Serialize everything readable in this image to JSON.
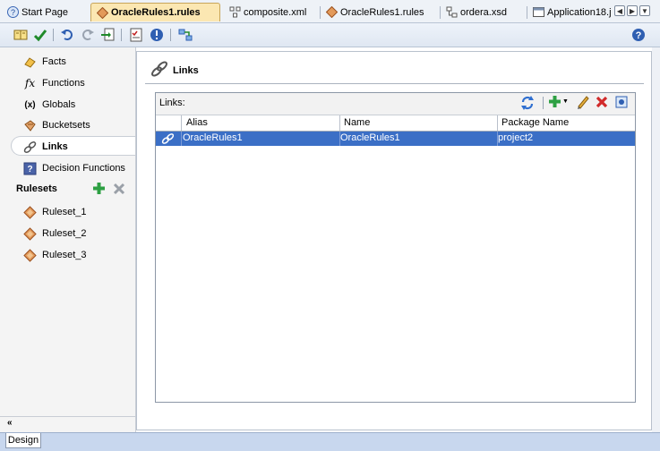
{
  "tabs": [
    {
      "label": "Start Page",
      "icon": "help-icon",
      "active": false
    },
    {
      "label": "OracleRules1.rules",
      "icon": "rules-diamond-icon",
      "active": true
    },
    {
      "label": "composite.xml",
      "icon": "composite-icon",
      "active": false
    },
    {
      "label": "OracleRules1.rules",
      "icon": "rules-diamond-icon",
      "active": false
    },
    {
      "label": "ordera.xsd",
      "icon": "xsd-icon",
      "active": false
    },
    {
      "label": "Application18.j",
      "icon": "application-icon",
      "active": false
    }
  ],
  "toolbar": {
    "items": [
      "dictionary-icon",
      "validate-check-icon",
      "undo-icon",
      "redo-icon",
      "import-icon",
      "checklist-icon",
      "info-icon",
      "test-icon",
      "help-icon"
    ]
  },
  "leftnav": {
    "items": [
      {
        "label": "Facts",
        "icon": "facts-icon"
      },
      {
        "label": "Functions",
        "icon": "functions-icon"
      },
      {
        "label": "Globals",
        "icon": "globals-icon"
      },
      {
        "label": "Bucketsets",
        "icon": "bucketsets-icon"
      },
      {
        "label": "Links",
        "icon": "links-icon",
        "selected": true
      },
      {
        "label": "Decision Functions",
        "icon": "decision-functions-icon"
      }
    ],
    "rulesets_header": "Rulesets",
    "rulesets": [
      {
        "label": "Ruleset_1"
      },
      {
        "label": "Ruleset_2"
      },
      {
        "label": "Ruleset_3"
      }
    ],
    "collapse_glyph": "«"
  },
  "main": {
    "title": "Links",
    "links_label": "Links:",
    "columns": [
      "Alias",
      "Name",
      "Package Name"
    ],
    "rows": [
      {
        "alias": "OracleRules1",
        "name": "OracleRules1",
        "package": "project2"
      }
    ]
  },
  "bottom": {
    "design_tab": "Design"
  },
  "colors": {
    "selection": "#3b6fc6",
    "active_tab": "#fbe7b2",
    "bottom_bar": "#c8d7ee"
  }
}
